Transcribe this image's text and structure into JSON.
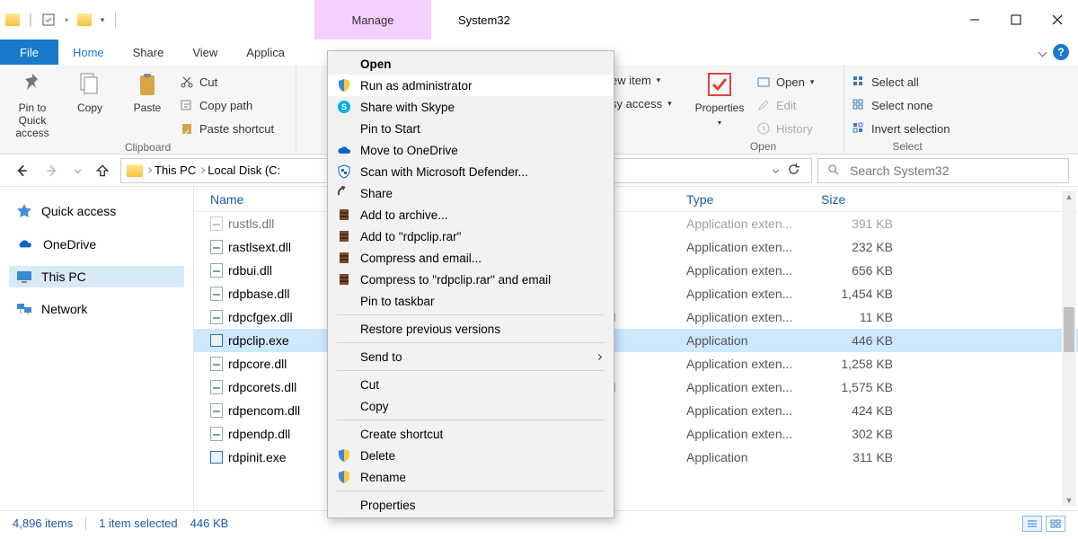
{
  "title": "System32",
  "manage_tab": "Manage",
  "ribbon_tabs": {
    "file": "File",
    "home": "Home",
    "share": "Share",
    "view": "View",
    "application": "Applica"
  },
  "ribbon": {
    "clipboard": {
      "label": "Clipboard",
      "pin": "Pin to Quick\naccess",
      "copy": "Copy",
      "paste": "Paste",
      "cut": "Cut",
      "copy_path": "Copy path",
      "paste_shortcut": "Paste shortcut"
    },
    "new": {
      "new_item": "ew item",
      "easy_access": "sy access"
    },
    "open": {
      "label": "Open",
      "properties": "Properties",
      "open_btn": "Open",
      "edit": "Edit",
      "history": "History"
    },
    "select": {
      "label": "Select",
      "select_all": "Select all",
      "select_none": "Select none",
      "invert": "Invert selection"
    }
  },
  "breadcrumbs": [
    "This PC",
    "Local Disk (C:"
  ],
  "search_placeholder": "Search System32",
  "sidebar": {
    "quick_access": "Quick access",
    "onedrive": "OneDrive",
    "this_pc": "This PC",
    "network": "Network"
  },
  "columns": {
    "name": "Name",
    "type": "Type",
    "size": "Size"
  },
  "files": [
    {
      "name": "rustls.dll",
      "type": "Application exten...",
      "size": "391 KB",
      "cut": true
    },
    {
      "name": "rastlsext.dll",
      "type": "Application exten...",
      "size": "232 KB"
    },
    {
      "name": "rdbui.dll",
      "type": "Application exten...",
      "size": "656 KB"
    },
    {
      "name": "rdpbase.dll",
      "type": "Application exten...",
      "size": "1,454 KB"
    },
    {
      "name": "rdpcfgex.dll",
      "type": "Application exten...",
      "size": "11 KB",
      "date": "M"
    },
    {
      "name": "rdpclip.exe",
      "type": "Application",
      "size": "446 KB",
      "exe": true,
      "selected": true
    },
    {
      "name": "rdpcore.dll",
      "type": "Application exten...",
      "size": "1,258 KB"
    },
    {
      "name": "rdpcorets.dll",
      "type": "Application exten...",
      "size": "1,575 KB",
      "date": "M"
    },
    {
      "name": "rdpencom.dll",
      "type": "Application exten...",
      "size": "424 KB"
    },
    {
      "name": "rdpendp.dll",
      "type": "Application exten...",
      "size": "302 KB"
    },
    {
      "name": "rdpinit.exe",
      "type": "Application",
      "size": "311 KB",
      "exe": true
    }
  ],
  "context_menu": [
    {
      "label": "Open",
      "bold": true
    },
    {
      "label": "Run as administrator",
      "icon": "shield",
      "hover": true
    },
    {
      "label": "Share with Skype",
      "icon": "skype"
    },
    {
      "label": "Pin to Start"
    },
    {
      "label": "Move to OneDrive",
      "icon": "cloud"
    },
    {
      "label": "Scan with Microsoft Defender...",
      "icon": "defender"
    },
    {
      "label": "Share",
      "icon": "share"
    },
    {
      "label": "Add to archive...",
      "icon": "rar"
    },
    {
      "label": "Add to \"rdpclip.rar\"",
      "icon": "rar"
    },
    {
      "label": "Compress and email...",
      "icon": "rar"
    },
    {
      "label": "Compress to \"rdpclip.rar\" and email",
      "icon": "rar"
    },
    {
      "label": "Pin to taskbar"
    },
    {
      "sep": true
    },
    {
      "label": "Restore previous versions"
    },
    {
      "sep": true
    },
    {
      "label": "Send to",
      "submenu": true
    },
    {
      "sep": true
    },
    {
      "label": "Cut"
    },
    {
      "label": "Copy"
    },
    {
      "sep": true
    },
    {
      "label": "Create shortcut"
    },
    {
      "label": "Delete",
      "icon": "shield"
    },
    {
      "label": "Rename",
      "icon": "shield"
    },
    {
      "sep": true
    },
    {
      "label": "Properties"
    }
  ],
  "status": {
    "items": "4,896 items",
    "selected": "1 item selected",
    "size": "446 KB"
  }
}
